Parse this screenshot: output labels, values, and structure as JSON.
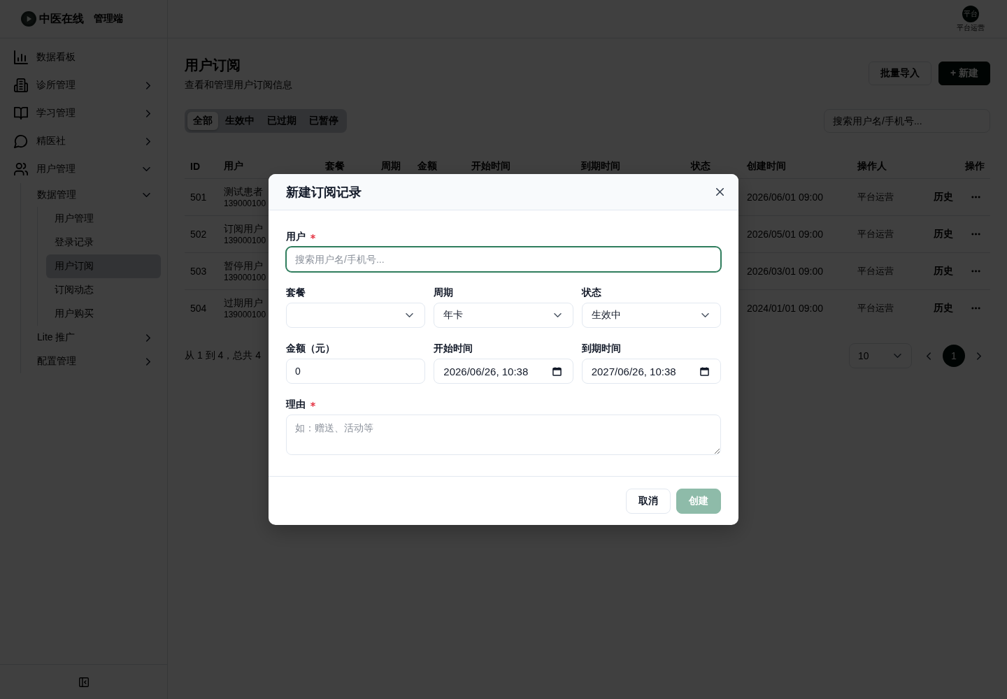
{
  "brand": {
    "name": "中医在线",
    "tag": "管理端"
  },
  "sidebar": {
    "items": [
      {
        "label": "数据看板",
        "selected": false
      },
      {
        "label": "诊所管理",
        "selected": false,
        "expanded": false
      },
      {
        "label": "学习管理",
        "selected": false,
        "expanded": false
      },
      {
        "label": "精医社",
        "selected": false,
        "expanded": false
      },
      {
        "label": "用户管理",
        "selected": false,
        "expanded": true,
        "children": [
          {
            "label": "数据管理",
            "selected": false,
            "expanded": true,
            "children": [
              {
                "label": "用户管理",
                "selected": false
              },
              {
                "label": "登录记录",
                "selected": false
              },
              {
                "label": "用户订阅",
                "selected": true
              },
              {
                "label": "订阅动态",
                "selected": false
              },
              {
                "label": "用户购买",
                "selected": false
              }
            ]
          },
          {
            "label": "Lite 推广",
            "selected": false,
            "expanded": false
          },
          {
            "label": "配置管理",
            "selected": false,
            "expanded": false
          }
        ]
      }
    ]
  },
  "top_bar": {
    "user": {
      "avatar_text": "平台",
      "name": "平台运营"
    }
  },
  "page": {
    "title": "用户订阅",
    "subtitle": "查看和管理用户订阅信息",
    "actions": [
      {
        "label": "批量导入",
        "kind": "secondary"
      },
      {
        "label": "+ 新建",
        "kind": "primary"
      }
    ]
  },
  "filter_tabs": [
    {
      "label": "全部",
      "selected": true
    },
    {
      "label": "生效中",
      "selected": false
    },
    {
      "label": "已过期",
      "selected": false
    },
    {
      "label": "已暂停",
      "selected": false
    }
  ],
  "search": {
    "placeholder": "搜索用户名/手机号..."
  },
  "table": {
    "columns": [
      "ID",
      "用户",
      "套餐",
      "周期",
      "金额",
      "开始时间",
      "到期时间",
      "状态",
      "创建时间",
      "操作人",
      "操作"
    ],
    "rows": [
      {
        "id": "501",
        "user_name": "测试患者",
        "user_phone": "139000100",
        "created_at": "2026/06/01 09:00",
        "operator": "平台运营",
        "action": "历史"
      },
      {
        "id": "502",
        "user_name": "订阅用户",
        "user_phone": "139000100",
        "created_at": "2026/05/01 09:00",
        "operator": "平台运营",
        "action": "历史"
      },
      {
        "id": "503",
        "user_name": "暂停用户",
        "user_phone": "139000100",
        "created_at": "2026/03/01 09:00",
        "operator": "平台运营",
        "action": "历史"
      },
      {
        "id": "504",
        "user_name": "过期用户",
        "user_phone": "139000100",
        "created_at": "2024/01/01 09:00",
        "operator": "平台运营",
        "action": "历史"
      }
    ]
  },
  "pagination": {
    "summary": "从 1 到 4，总共 4",
    "page_size": "10",
    "pages": [
      {
        "label": "1",
        "selected": true
      }
    ]
  },
  "modal": {
    "title": "新建订阅记录",
    "fields": [
      {
        "kind": "search",
        "label": "用户",
        "required": true,
        "focused": true,
        "placeholder": "搜索用户名/手机号..."
      },
      {
        "kind": "select",
        "label": "套餐",
        "required": false,
        "focused": false
      },
      {
        "kind": "select",
        "label": "周期",
        "required": false,
        "focused": false,
        "value": "年卡"
      },
      {
        "kind": "select",
        "label": "状态",
        "required": false,
        "focused": false,
        "value": "生效中"
      },
      {
        "kind": "number",
        "label": "金额（元）",
        "required": false,
        "focused": false,
        "value": "0"
      },
      {
        "kind": "datetime",
        "label": "开始时间",
        "required": false,
        "focused": false,
        "value": "2026/06/26, 10:38"
      },
      {
        "kind": "datetime",
        "label": "到期时间",
        "required": false,
        "focused": false,
        "value": "2027/06/26, 10:38"
      },
      {
        "kind": "textarea",
        "label": "理由",
        "required": true,
        "focused": false,
        "placeholder": "如：赠送、活动等"
      }
    ],
    "buttons": [
      {
        "label": "取消",
        "kind": "secondary",
        "disabled": false
      },
      {
        "label": "创建",
        "kind": "primary",
        "disabled": true
      }
    ]
  }
}
